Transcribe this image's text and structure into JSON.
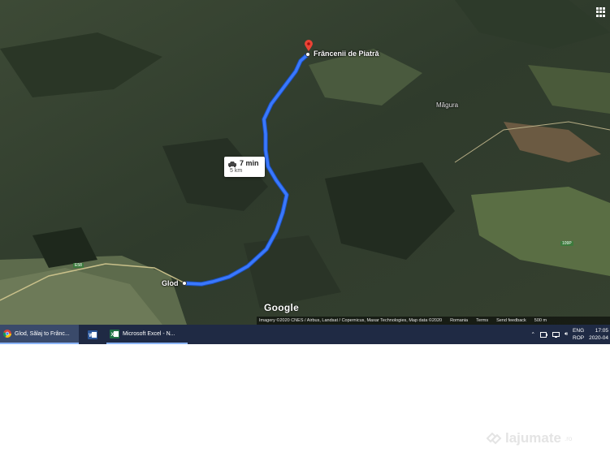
{
  "map": {
    "destination_label": "Frâncenii de Piatră",
    "origin_label": "Glod",
    "nearby_label": "Măgura",
    "route": {
      "time": "7 min",
      "distance": "5 km",
      "travel_mode_icon": "car-icon"
    },
    "road_badges": [
      "E58",
      "109P"
    ],
    "logo": "Google",
    "attribution": {
      "imagery": "Imagery ©2020 CNES / Airbus, Landsat / Copernicus, Maxar Technologies, Map data ©2020",
      "country": "Romania",
      "terms": "Terms",
      "feedback": "Send feedback",
      "scale": "500 m"
    },
    "route_color": "#3a78ff",
    "pin_color": "#ea4335"
  },
  "taskbar": {
    "items": [
      {
        "label": "Glod, Sălaj to Frânc...",
        "icon": "chrome-icon"
      },
      {
        "label": "",
        "icon": "word-icon"
      },
      {
        "label": "Microsoft Excel - N...",
        "icon": "excel-icon"
      }
    ],
    "tray": {
      "lang_top": "ENG",
      "lang_bottom": "ROP",
      "time": "17:05",
      "date": "2020-04"
    }
  },
  "watermark": {
    "brand": "lajumate",
    "tld": ".ro"
  }
}
